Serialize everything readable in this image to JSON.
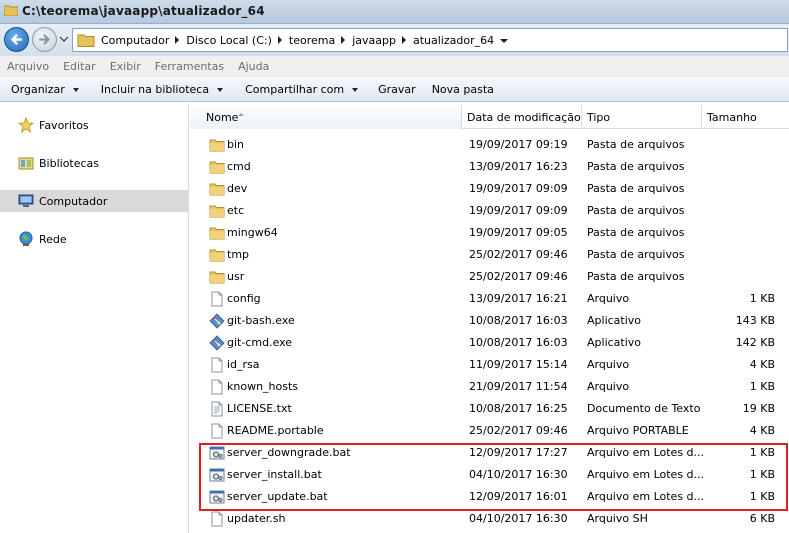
{
  "window": {
    "title": "C:\\teorema\\javaapp\\atualizador_64"
  },
  "address": {
    "crumbs": [
      "Computador",
      "Disco Local (C:)",
      "teorema",
      "javaapp",
      "atualizador_64"
    ]
  },
  "menu": [
    "Arquivo",
    "Editar",
    "Exibir",
    "Ferramentas",
    "Ajuda"
  ],
  "toolbar": {
    "organize": "Organizar",
    "include_library": "Incluir na biblioteca",
    "share": "Compartilhar com",
    "burn": "Gravar",
    "new_folder": "Nova pasta"
  },
  "nav": {
    "favorites": "Favoritos",
    "libraries": "Bibliotecas",
    "computer": "Computador",
    "network": "Rede"
  },
  "columns": {
    "name": "Nome",
    "date": "Data de modificação",
    "type": "Tipo",
    "size": "Tamanho"
  },
  "files": [
    {
      "name": "bin",
      "date": "19/09/2017 09:19",
      "type": "Pasta de arquivos",
      "size": "",
      "icon": "folder-icon"
    },
    {
      "name": "cmd",
      "date": "13/09/2017 16:23",
      "type": "Pasta de arquivos",
      "size": "",
      "icon": "folder-icon"
    },
    {
      "name": "dev",
      "date": "19/09/2017 09:09",
      "type": "Pasta de arquivos",
      "size": "",
      "icon": "folder-icon"
    },
    {
      "name": "etc",
      "date": "19/09/2017 09:09",
      "type": "Pasta de arquivos",
      "size": "",
      "icon": "folder-icon"
    },
    {
      "name": "mingw64",
      "date": "19/09/2017 09:05",
      "type": "Pasta de arquivos",
      "size": "",
      "icon": "folder-icon"
    },
    {
      "name": "tmp",
      "date": "25/02/2017 09:46",
      "type": "Pasta de arquivos",
      "size": "",
      "icon": "folder-icon"
    },
    {
      "name": "usr",
      "date": "25/02/2017 09:46",
      "type": "Pasta de arquivos",
      "size": "",
      "icon": "folder-icon"
    },
    {
      "name": "config",
      "date": "13/09/2017 16:21",
      "type": "Arquivo",
      "size": "1 KB",
      "icon": "file-icon"
    },
    {
      "name": "git-bash.exe",
      "date": "10/08/2017 16:03",
      "type": "Aplicativo",
      "size": "143 KB",
      "icon": "git-app-icon"
    },
    {
      "name": "git-cmd.exe",
      "date": "10/08/2017 16:03",
      "type": "Aplicativo",
      "size": "142 KB",
      "icon": "git-app-icon"
    },
    {
      "name": "id_rsa",
      "date": "11/09/2017 15:14",
      "type": "Arquivo",
      "size": "4 KB",
      "icon": "file-icon"
    },
    {
      "name": "known_hosts",
      "date": "21/09/2017 11:54",
      "type": "Arquivo",
      "size": "1 KB",
      "icon": "file-icon"
    },
    {
      "name": "LICENSE.txt",
      "date": "10/08/2017 16:25",
      "type": "Documento de Texto",
      "size": "19 KB",
      "icon": "text-file-icon"
    },
    {
      "name": "README.portable",
      "date": "25/02/2017 09:46",
      "type": "Arquivo PORTABLE",
      "size": "4 KB",
      "icon": "file-icon"
    },
    {
      "name": "server_downgrade.bat",
      "date": "12/09/2017 17:27",
      "type": "Arquivo em Lotes d...",
      "size": "1 KB",
      "icon": "batch-file-icon"
    },
    {
      "name": "server_install.bat",
      "date": "04/10/2017 16:30",
      "type": "Arquivo em Lotes d...",
      "size": "1 KB",
      "icon": "batch-file-icon"
    },
    {
      "name": "server_update.bat",
      "date": "12/09/2017 16:01",
      "type": "Arquivo em Lotes d...",
      "size": "1 KB",
      "icon": "batch-file-icon"
    },
    {
      "name": "updater.sh",
      "date": "04/10/2017 16:30",
      "type": "Arquivo SH",
      "size": "6 KB",
      "icon": "file-icon"
    }
  ],
  "colors": {
    "highlight": "#e02020",
    "selection": "#d9d9d9"
  }
}
